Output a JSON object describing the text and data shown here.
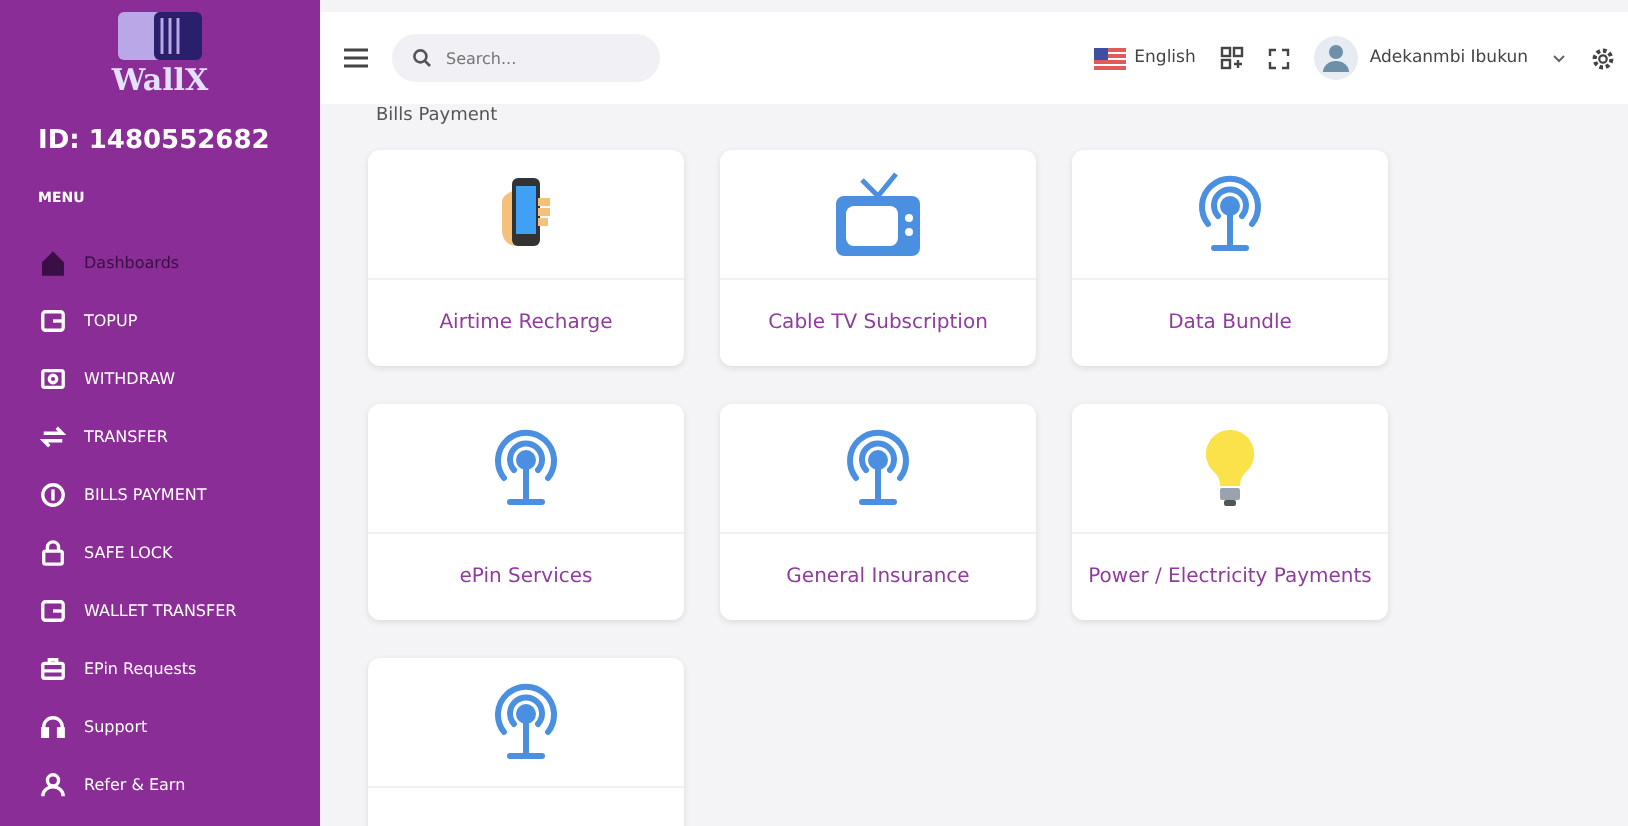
{
  "sidebar": {
    "logo_text": "WallX",
    "id_label": "ID: 1480552682",
    "menu_heading": "MENU",
    "items": [
      {
        "label": "Dashboards",
        "kind": "home",
        "selected": true
      },
      {
        "label": "TOPUP",
        "kind": "wallet",
        "selected": false
      },
      {
        "label": "WITHDRAW",
        "kind": "cash",
        "selected": false
      },
      {
        "label": "TRANSFER",
        "kind": "swap",
        "selected": false
      },
      {
        "label": "BILLS PAYMENT",
        "kind": "coin",
        "selected": false
      },
      {
        "label": "SAFE LOCK",
        "kind": "lock",
        "selected": false
      },
      {
        "label": "WALLET TRANSFER",
        "kind": "wallet",
        "selected": false
      },
      {
        "label": "EPin Requests",
        "kind": "briefcase",
        "selected": false
      },
      {
        "label": "Support",
        "kind": "headset",
        "selected": false
      },
      {
        "label": "Refer & Earn",
        "kind": "user",
        "selected": false
      }
    ]
  },
  "header": {
    "search": {
      "placeholder": "Search..."
    },
    "language": "English",
    "user_name": "Adekanmbi Ibukun"
  },
  "page_title": "Bills Payment",
  "cards": [
    {
      "label": "Airtime Recharge",
      "kind": "phone"
    },
    {
      "label": "Cable TV Subscription",
      "kind": "tv"
    },
    {
      "label": "Data Bundle",
      "kind": "antenna"
    },
    {
      "label": "ePin Services",
      "kind": "antenna"
    },
    {
      "label": "General Insurance",
      "kind": "antenna"
    },
    {
      "label": "Power / Electricity Payments",
      "kind": "bulb"
    },
    {
      "kind": "antenna"
    }
  ]
}
